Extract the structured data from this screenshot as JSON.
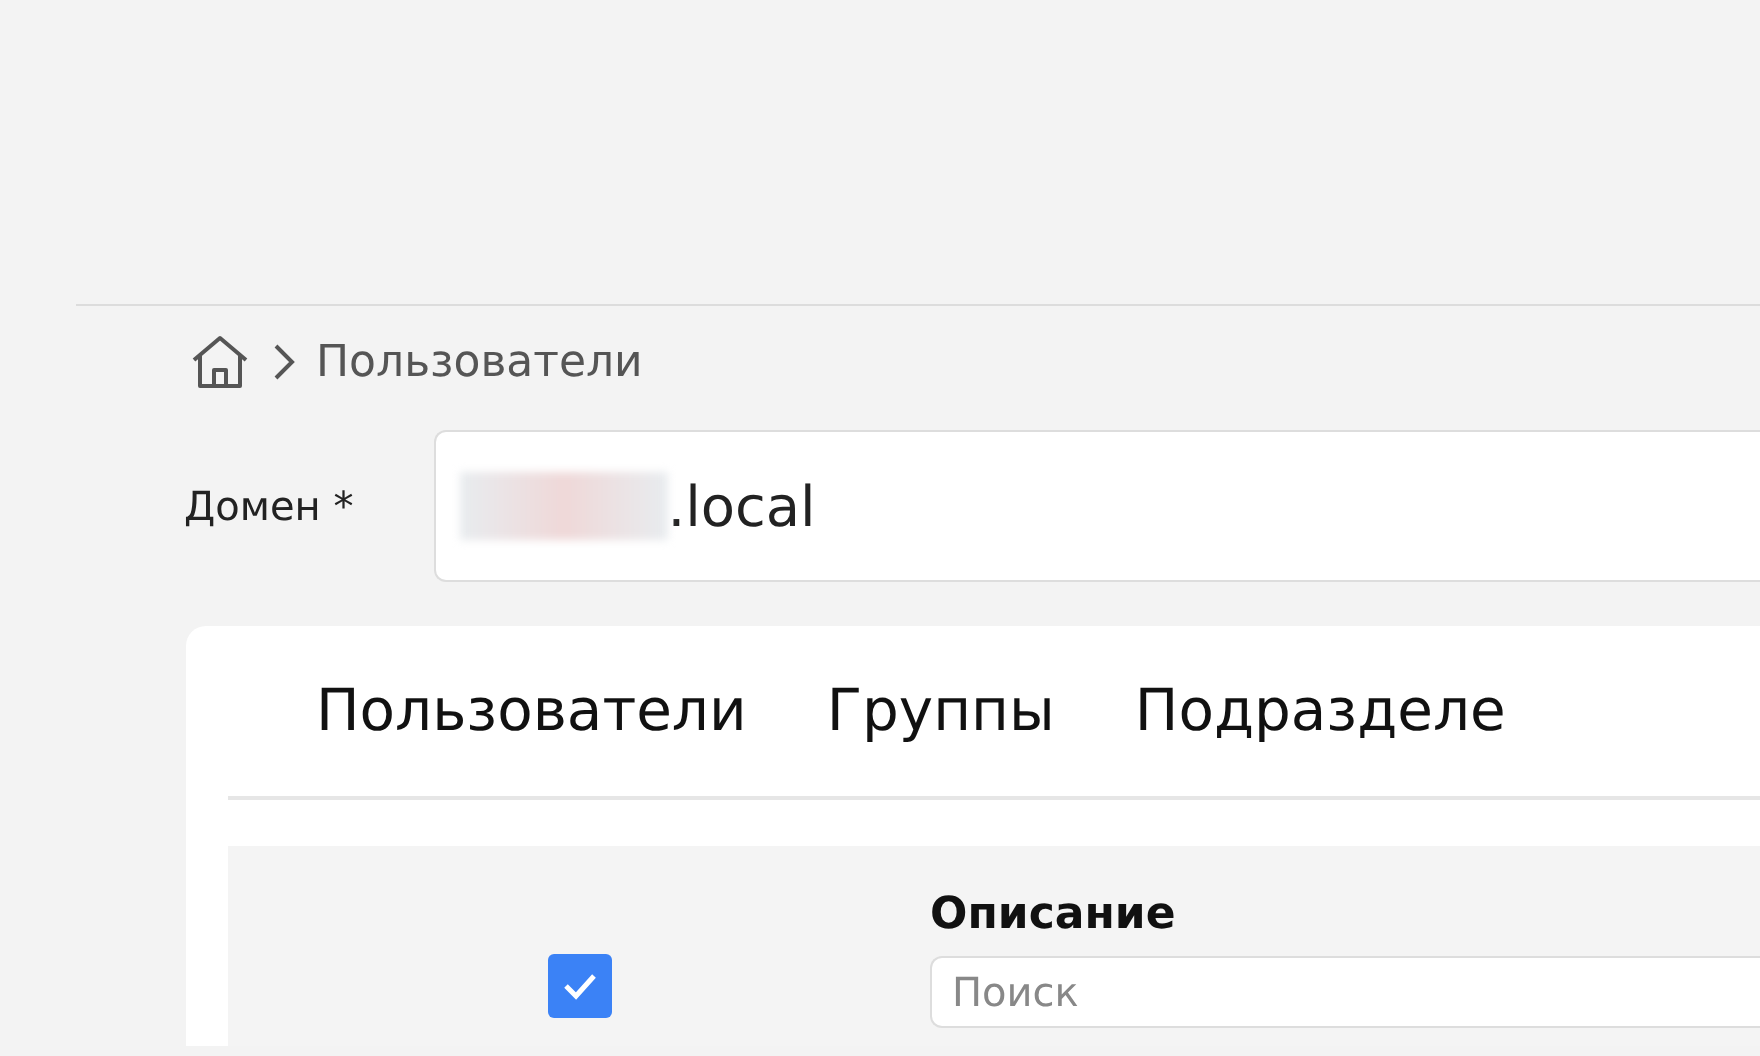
{
  "breadcrumb": {
    "current": "Пользователи"
  },
  "domain": {
    "label": "Домен *",
    "value": ".local",
    "redacted": true
  },
  "tabs": [
    {
      "label": "Пользователи"
    },
    {
      "label": "Группы"
    },
    {
      "label": "Подразделе"
    }
  ],
  "table": {
    "select_all": {
      "checked": true
    },
    "columns": [
      {
        "title": "Описание",
        "search_placeholder": "Поиск"
      }
    ]
  }
}
